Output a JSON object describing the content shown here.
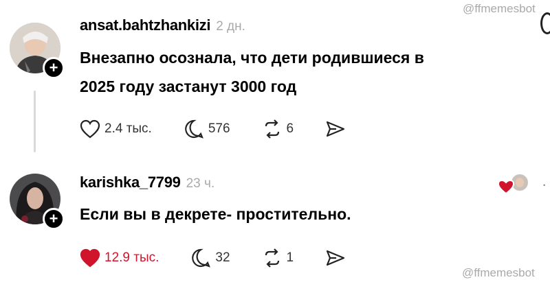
{
  "watermark": "@ffmemesbot",
  "post": {
    "username": "ansat.bahtzhankizi",
    "time": "2 дн.",
    "text_line1": "Внезапно осознала, что дети родившиеся в",
    "text_line2": "2025 году застанут 3000 год",
    "likes": "2.4 тыс.",
    "comments": "576",
    "reposts": "6"
  },
  "reply": {
    "username": "karishka_7799",
    "time": "23 ч.",
    "text": "Если вы в декрете- простительно.",
    "likes": "12.9 тыс.",
    "comments": "32",
    "reposts": "1"
  },
  "colors": {
    "liked_red": "#d0142c",
    "muted": "#a9a9a9"
  },
  "icons": [
    "follow-plus-icon",
    "heart-icon",
    "comment-icon",
    "repost-icon",
    "share-icon",
    "liked-by-author-icon",
    "more-icon"
  ]
}
